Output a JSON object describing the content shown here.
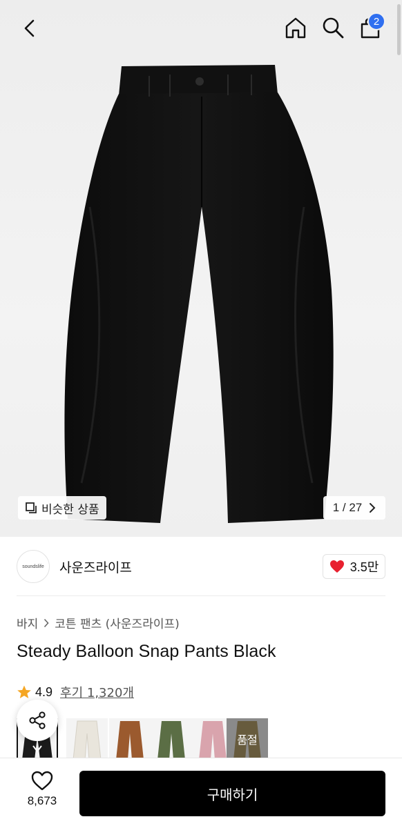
{
  "header": {
    "back_icon": "chevron-left-icon",
    "home_icon": "home-icon",
    "search_icon": "search-icon",
    "cart_icon": "shopping-bag-icon",
    "cart_badge": "2"
  },
  "gallery": {
    "similar_label": "비슷한 상품",
    "counter": "1 / 27"
  },
  "brand": {
    "logo_text": "soundslife",
    "name": "사운즈라이프",
    "likes": "3.5만"
  },
  "breadcrumb": {
    "category": "바지",
    "subcategory": "코튼 팬츠 (사운즈라이프)"
  },
  "product": {
    "title": "Steady Balloon Snap Pants Black",
    "rating": "4.9",
    "reviews": "후기 1,320개"
  },
  "thumbnails": [
    {
      "color_name": "black",
      "color": "#1b1b1b"
    },
    {
      "color_name": "ivory",
      "color": "#e9e5dc"
    },
    {
      "color_name": "brown",
      "color": "#9b5a2e"
    },
    {
      "color_name": "olive",
      "color": "#5b6e45"
    },
    {
      "color_name": "pink",
      "color": "#d9a4ad"
    },
    {
      "color_name": "khaki",
      "color": "#8a7a52",
      "soldout": "품절"
    }
  ],
  "bottom_bar": {
    "wish_count": "8,673",
    "buy_label": "구매하기"
  },
  "colors": {
    "badge": "#2f6ff0",
    "heart": "#e8202f",
    "star": "#f5a623",
    "buy_button": "#000000"
  }
}
